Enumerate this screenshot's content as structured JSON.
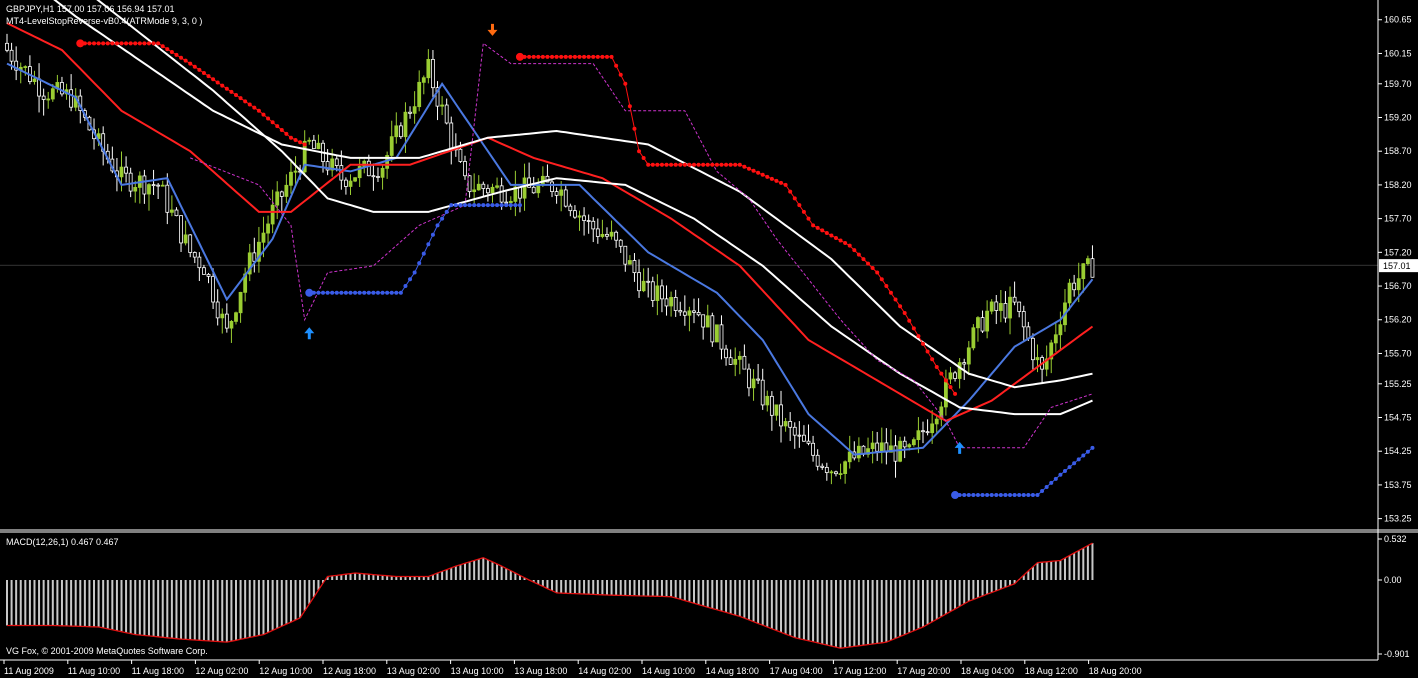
{
  "chart_data": {
    "type": "candlestick",
    "symbol_line": "GBPJPY,H1 157.00 157.06 156.94 157.01",
    "indicator_line": "MT4-LevelStopReverse-vB0.4(ATRMode 9, 3, 0 )",
    "current_price": "157.01",
    "price_ticks": [
      "160.65",
      "160.15",
      "159.70",
      "159.20",
      "158.70",
      "158.20",
      "157.70",
      "157.20",
      "156.70",
      "156.20",
      "155.70",
      "155.25",
      "154.75",
      "154.25",
      "153.75",
      "153.25"
    ],
    "ylim": [
      153.2,
      160.75
    ],
    "time_labels": [
      "11 Aug 2009",
      "11 Aug 10:00",
      "11 Aug 18:00",
      "12 Aug 02:00",
      "12 Aug 10:00",
      "12 Aug 18:00",
      "13 Aug 02:00",
      "13 Aug 10:00",
      "13 Aug 18:00",
      "14 Aug 02:00",
      "14 Aug 10:00",
      "14 Aug 18:00",
      "17 Aug 04:00",
      "17 Aug 12:00",
      "17 Aug 20:00",
      "18 Aug 04:00",
      "18 Aug 12:00",
      "18 Aug 20:00"
    ],
    "close_anchors": [
      [
        0,
        160.2
      ],
      [
        8,
        159.6
      ],
      [
        14,
        159.5
      ],
      [
        20,
        158.8
      ],
      [
        25,
        158.3
      ],
      [
        33,
        158.2
      ],
      [
        40,
        157.2
      ],
      [
        43,
        157.0
      ],
      [
        48,
        156.0
      ],
      [
        52,
        156.9
      ],
      [
        58,
        157.8
      ],
      [
        66,
        158.8
      ],
      [
        73,
        158.3
      ],
      [
        82,
        158.5
      ],
      [
        92,
        159.9
      ],
      [
        95,
        159.3
      ],
      [
        100,
        158.2
      ],
      [
        110,
        158.1
      ],
      [
        120,
        158.2
      ],
      [
        127,
        157.6
      ],
      [
        132,
        157.4
      ],
      [
        140,
        156.6
      ],
      [
        150,
        156.4
      ],
      [
        160,
        155.5
      ],
      [
        170,
        154.6
      ],
      [
        176,
        154.2
      ],
      [
        180,
        154.0
      ],
      [
        190,
        154.3
      ],
      [
        197,
        154.2
      ],
      [
        203,
        154.9
      ],
      [
        208,
        155.6
      ],
      [
        214,
        156.3
      ],
      [
        220,
        156.4
      ],
      [
        226,
        155.4
      ],
      [
        232,
        156.7
      ],
      [
        237,
        157.0
      ]
    ],
    "bar_count": 238,
    "lines": [
      {
        "name": "blue-ma",
        "color": "#4a78e0",
        "anchors": [
          [
            0,
            160.0
          ],
          [
            15,
            159.5
          ],
          [
            25,
            158.2
          ],
          [
            35,
            158.3
          ],
          [
            48,
            156.5
          ],
          [
            58,
            157.4
          ],
          [
            65,
            158.5
          ],
          [
            75,
            158.4
          ],
          [
            85,
            158.6
          ],
          [
            95,
            159.7
          ],
          [
            110,
            158.2
          ],
          [
            125,
            158.2
          ],
          [
            140,
            157.2
          ],
          [
            155,
            156.6
          ],
          [
            165,
            155.9
          ],
          [
            175,
            154.8
          ],
          [
            185,
            154.2
          ],
          [
            200,
            154.3
          ],
          [
            210,
            155.0
          ],
          [
            220,
            155.8
          ],
          [
            230,
            156.2
          ],
          [
            237,
            156.8
          ]
        ]
      },
      {
        "name": "red-ma",
        "color": "#ff2020",
        "anchors": [
          [
            0,
            160.6
          ],
          [
            12,
            160.2
          ],
          [
            25,
            159.3
          ],
          [
            40,
            158.7
          ],
          [
            55,
            157.8
          ],
          [
            62,
            157.8
          ],
          [
            75,
            158.5
          ],
          [
            88,
            158.5
          ],
          [
            105,
            158.9
          ],
          [
            115,
            158.6
          ],
          [
            130,
            158.3
          ],
          [
            145,
            157.7
          ],
          [
            160,
            157.0
          ],
          [
            175,
            155.9
          ],
          [
            185,
            155.5
          ],
          [
            195,
            155.1
          ],
          [
            205,
            154.7
          ],
          [
            215,
            155.0
          ],
          [
            225,
            155.5
          ],
          [
            237,
            156.1
          ]
        ]
      },
      {
        "name": "white-upper",
        "color": "#ffffff",
        "anchors": [
          [
            0,
            161.5
          ],
          [
            15,
            160.7
          ],
          [
            30,
            160.0
          ],
          [
            45,
            159.3
          ],
          [
            60,
            158.8
          ],
          [
            75,
            158.6
          ],
          [
            90,
            158.6
          ],
          [
            105,
            158.9
          ],
          [
            120,
            159.0
          ],
          [
            140,
            158.8
          ],
          [
            160,
            158.1
          ],
          [
            180,
            157.1
          ],
          [
            195,
            156.1
          ],
          [
            210,
            155.4
          ],
          [
            220,
            155.2
          ],
          [
            230,
            155.3
          ],
          [
            237,
            155.4
          ]
        ]
      },
      {
        "name": "white-lower",
        "color": "#ffffff",
        "anchors": [
          [
            0,
            161.9
          ],
          [
            15,
            161.2
          ],
          [
            30,
            160.4
          ],
          [
            45,
            159.6
          ],
          [
            60,
            158.7
          ],
          [
            70,
            158.0
          ],
          [
            80,
            157.8
          ],
          [
            92,
            157.8
          ],
          [
            108,
            158.1
          ],
          [
            120,
            158.3
          ],
          [
            135,
            158.2
          ],
          [
            150,
            157.7
          ],
          [
            165,
            157.0
          ],
          [
            180,
            156.1
          ],
          [
            195,
            155.4
          ],
          [
            208,
            154.9
          ],
          [
            220,
            154.8
          ],
          [
            230,
            154.8
          ],
          [
            237,
            155.0
          ]
        ]
      }
    ],
    "stop_red_dots": {
      "color": "#ff1010",
      "segments": [
        [
          [
            16,
            160.3
          ],
          [
            33,
            160.3
          ],
          [
            40,
            160.0
          ],
          [
            55,
            159.3
          ],
          [
            62,
            158.9
          ],
          [
            65,
            158.8
          ]
        ],
        [
          [
            112,
            160.1
          ],
          [
            132,
            160.1
          ],
          [
            135,
            159.7
          ],
          [
            138,
            158.7
          ],
          [
            140,
            158.5
          ],
          [
            160,
            158.5
          ],
          [
            170,
            158.2
          ],
          [
            176,
            157.6
          ],
          [
            184,
            157.3
          ],
          [
            190,
            156.9
          ],
          [
            196,
            156.3
          ],
          [
            203,
            155.5
          ],
          [
            207,
            155.1
          ]
        ]
      ]
    },
    "stop_blue_dots": {
      "color": "#3a5ce8",
      "segments": [
        [
          [
            66,
            156.6
          ],
          [
            86,
            156.6
          ],
          [
            89,
            156.9
          ],
          [
            94,
            157.6
          ],
          [
            97,
            157.9
          ],
          [
            112,
            157.9
          ]
        ],
        [
          [
            207,
            153.6
          ],
          [
            225,
            153.6
          ],
          [
            230,
            153.9
          ],
          [
            237,
            154.3
          ]
        ]
      ]
    },
    "magenta_dashed": {
      "color": "#cc33cc",
      "segments": [
        [
          [
            40,
            158.6
          ],
          [
            55,
            158.2
          ],
          [
            62,
            157.6
          ],
          [
            65,
            156.2
          ],
          [
            70,
            156.9
          ],
          [
            80,
            157.0
          ],
          [
            90,
            157.6
          ],
          [
            100,
            157.9
          ],
          [
            104,
            160.3
          ],
          [
            110,
            160.0
          ],
          [
            128,
            160.0
          ],
          [
            135,
            159.3
          ],
          [
            148,
            159.3
          ],
          [
            155,
            158.4
          ],
          [
            162,
            158.0
          ],
          [
            168,
            157.4
          ],
          [
            175,
            156.8
          ],
          [
            182,
            156.2
          ],
          [
            190,
            155.6
          ],
          [
            198,
            155.3
          ],
          [
            205,
            154.7
          ],
          [
            208,
            154.3
          ],
          [
            222,
            154.3
          ],
          [
            228,
            154.9
          ],
          [
            237,
            155.1
          ]
        ]
      ]
    },
    "arrows_up": [
      [
        66,
        156.0
      ],
      [
        208,
        154.3
      ]
    ],
    "arrows_down": [
      [
        106,
        160.5
      ]
    ],
    "macd": {
      "label": "MACD(12,26,1) 0.467 0.467",
      "ticks": [
        "0.532",
        "0.00",
        "-0.901"
      ],
      "ylim": [
        -0.95,
        0.56
      ],
      "anchors": [
        [
          0,
          -0.6
        ],
        [
          10,
          -0.6
        ],
        [
          20,
          -0.62
        ],
        [
          28,
          -0.72
        ],
        [
          38,
          -0.78
        ],
        [
          48,
          -0.82
        ],
        [
          56,
          -0.72
        ],
        [
          64,
          -0.5
        ],
        [
          70,
          0.05
        ],
        [
          76,
          0.1
        ],
        [
          85,
          0.05
        ],
        [
          92,
          0.05
        ],
        [
          98,
          0.2
        ],
        [
          104,
          0.32
        ],
        [
          108,
          0.2
        ],
        [
          114,
          0.0
        ],
        [
          120,
          -0.17
        ],
        [
          132,
          -0.2
        ],
        [
          145,
          -0.22
        ],
        [
          160,
          -0.48
        ],
        [
          172,
          -0.76
        ],
        [
          182,
          -0.9
        ],
        [
          192,
          -0.82
        ],
        [
          200,
          -0.62
        ],
        [
          210,
          -0.28
        ],
        [
          220,
          -0.05
        ],
        [
          225,
          0.25
        ],
        [
          230,
          0.28
        ],
        [
          237,
          0.53
        ]
      ]
    },
    "footer": "VG Fox, © 2001-2009 MetaQuotes Software Corp.",
    "colors": {
      "bull": "#9acd32",
      "bear": "#ffffff",
      "grid": "#2a2a2a",
      "axis": "#ffffff"
    }
  }
}
